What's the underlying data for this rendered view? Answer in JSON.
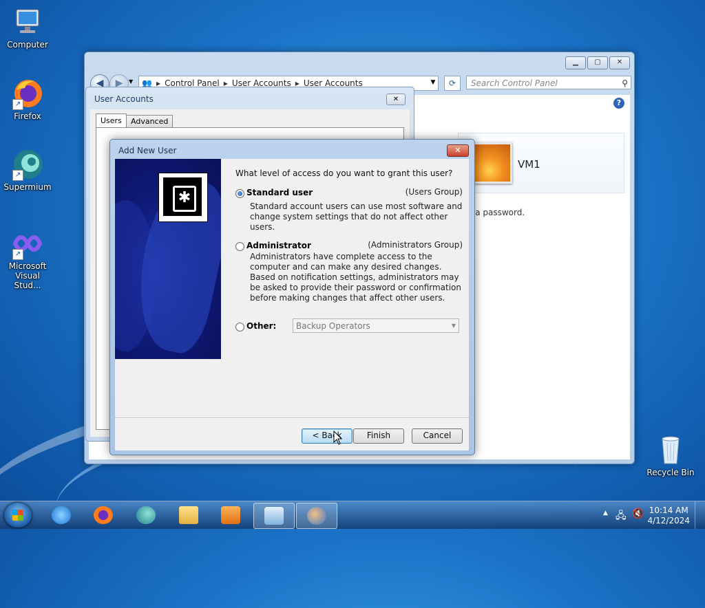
{
  "desktop": {
    "icons": [
      {
        "label": "Computer"
      },
      {
        "label": "Firefox"
      },
      {
        "label": "Supermium"
      },
      {
        "label": "Microsoft Visual Stud..."
      },
      {
        "label": "Recycle Bin"
      }
    ]
  },
  "control_panel": {
    "breadcrumb": [
      "Control Panel",
      "User Accounts",
      "User Accounts"
    ],
    "search_placeholder": "Search Control Panel",
    "user_name": "VM1",
    "password_text": "e a password."
  },
  "user_accounts_dialog": {
    "title": "User Accounts",
    "tabs": [
      "Users",
      "Advanced"
    ]
  },
  "wizard": {
    "title": "Add New User",
    "question": "What level of access do you want to grant this user?",
    "options": [
      {
        "label": "Standard user",
        "group": "(Users Group)",
        "selected": true,
        "description": "Standard account users can use most software and change system settings that do not affect other users."
      },
      {
        "label": "Administrator",
        "group": "(Administrators Group)",
        "selected": false,
        "description": "Administrators have complete access to the computer and can make any desired changes. Based on notification settings, administrators may be asked to provide their password or confirmation before making changes that affect other users."
      },
      {
        "label": "Other:",
        "selected": false,
        "select_value": "Backup Operators"
      }
    ],
    "buttons": {
      "back": "< Back",
      "finish": "Finish",
      "cancel": "Cancel"
    }
  },
  "taskbar": {
    "clock_time": "10:14 AM",
    "clock_date": "4/12/2024",
    "items": [
      "internet-explorer",
      "firefox",
      "supermium",
      "file-explorer",
      "media-player",
      "control-panel",
      "user-accounts"
    ]
  },
  "colors": {
    "desktop": "#1b73c8",
    "wizard_art": "#0f1a78",
    "close_button": "#c8442c",
    "focus_button": "#b8dcf4"
  }
}
